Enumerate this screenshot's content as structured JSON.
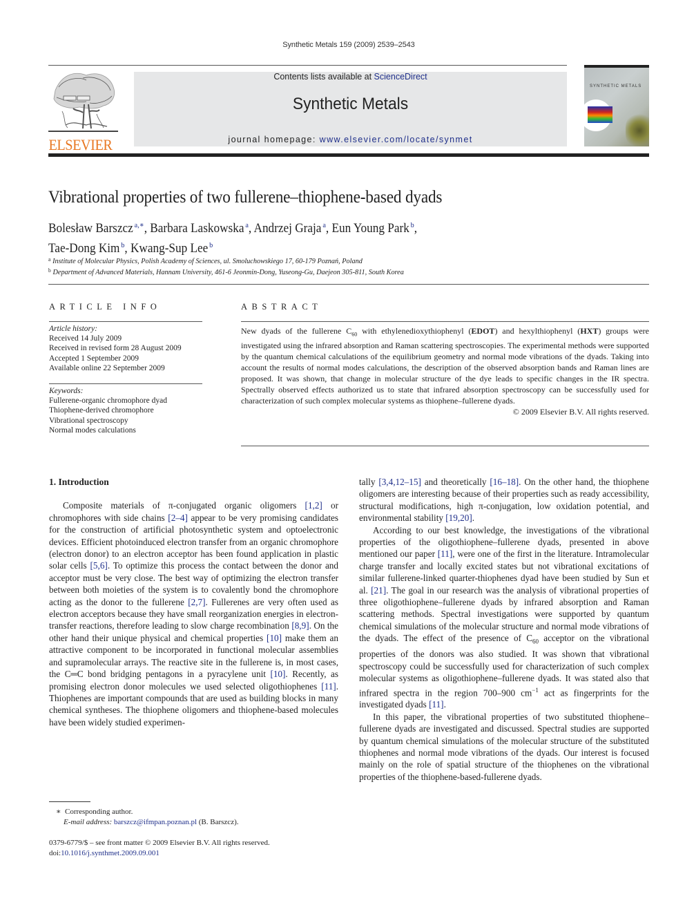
{
  "running_head": "Synthetic Metals 159 (2009) 2539–2543",
  "masthead": {
    "publisher_logo_text": "ELSEVIER",
    "contents_prefix": "Contents lists available at ",
    "contents_link": "ScienceDirect",
    "journal_title": "Synthetic Metals",
    "homepage_prefix": "journal homepage: ",
    "homepage_link": "www.elsevier.com/locate/synmet",
    "cover_title": "SYNTHETIC METALS"
  },
  "colors": {
    "elsevier_orange": "#e87722",
    "link_blue": "#1f2f8a",
    "masthead_grey": "#e6e7e8"
  },
  "article": {
    "title": "Vibrational properties of two fullerene–thiophene-based dyads",
    "authors": [
      {
        "name": "Bolesław Barszcz",
        "affil": "a,∗",
        "sep": ", "
      },
      {
        "name": "Barbara Laskowska",
        "affil": "a",
        "sep": ", "
      },
      {
        "name": "Andrzej Graja",
        "affil": "a",
        "sep": ", "
      },
      {
        "name": "Eun Young Park",
        "affil": "b",
        "sep": ","
      },
      {
        "name": "Tae-Dong Kim",
        "affil": "b",
        "sep": ", "
      },
      {
        "name": "Kwang-Sup Lee",
        "affil": "b",
        "sep": ""
      }
    ],
    "affiliations": [
      {
        "mark": "a",
        "text": "Institute of Molecular Physics, Polish Academy of Sciences, ul. Smoluchowskiego 17, 60-179 Poznań, Poland"
      },
      {
        "mark": "b",
        "text": "Department of Advanced Materials, Hannam University, 461-6 Jeonmin-Dong, Yuseong-Gu, Daejeon 305-811, South Korea"
      }
    ]
  },
  "article_info": {
    "heading": "ARTICLE INFO",
    "history_label": "Article history:",
    "history": [
      "Received 14 July 2009",
      "Received in revised form 28 August 2009",
      "Accepted 1 September 2009",
      "Available online 22 September 2009"
    ],
    "keywords_label": "Keywords:",
    "keywords": [
      "Fullerene-organic chromophore dyad",
      "Thiophene-derived chromophore",
      "Vibrational spectroscopy",
      "Normal modes calculations"
    ]
  },
  "abstract": {
    "heading": "ABSTRACT",
    "p1_a": "New dyads of the fullerene C",
    "p1_sub": "60",
    "p1_b": " with ethylenedioxythiophenyl (",
    "p1_edot": "EDOT",
    "p1_c": ") and hexylthiophenyl (",
    "p1_hxt": "HXT",
    "p1_d": ") groups were investigated using the infrared absorption and Raman scattering spectroscopies. The experimental methods were supported by the quantum chemical calculations of the equilibrium geometry and normal mode vibrations of the dyads. Taking into account the results of normal modes calculations, the description of the observed absorption bands and Raman lines are proposed. It was shown, that change in molecular structure of the dye leads to specific changes in the IR spectra. Spectrally observed effects authorized us to state that infrared absorption spectroscopy can be successfully used for characterization of such complex molecular systems as thiophene–fullerene dyads.",
    "copyright": "© 2009 Elsevier B.V. All rights reserved."
  },
  "introduction": {
    "heading": "1.  Introduction",
    "left_p1": [
      {
        "t": "Composite materials of π-conjugated organic oligomers "
      },
      {
        "ref": "[1,2]"
      },
      {
        "t": " or chromophores with side chains "
      },
      {
        "ref": "[2–4]"
      },
      {
        "t": " appear to be very promising candidates for the construction of artificial photosynthetic system and optoelectronic devices. Efficient photoinduced electron transfer from an organic chromophore (electron donor) to an electron acceptor has been found application in plastic solar cells "
      },
      {
        "ref": "[5,6]"
      },
      {
        "t": ". To optimize this process the contact between the donor and acceptor must be very close. The best way of optimizing the electron transfer between both moieties of the system is to covalently bond the chromophore acting as the donor to the fullerene "
      },
      {
        "ref": "[2,7]"
      },
      {
        "t": ". Fullerenes are very often used as electron acceptors because they have small reorganization energies in electron-transfer reactions, therefore leading to slow charge recombination "
      },
      {
        "ref": "[8,9]"
      },
      {
        "t": ". On the other hand their unique physical and chemical properties "
      },
      {
        "ref": "[10]"
      },
      {
        "t": " make them an attractive component to be incorporated in functional molecular assemblies and supramolecular arrays. The reactive site in the fullerene is, in most cases, the C═C bond bridging pentagons in a pyracylene unit "
      },
      {
        "ref": "[10]"
      },
      {
        "t": ". Recently, as promising electron donor molecules we used selected oligothiophenes "
      },
      {
        "ref": "[11]"
      },
      {
        "t": ". Thiophenes are important compounds that are used as building blocks in many chemical syntheses. The thiophene oligomers and thiophene-based molecules have been widely studied experimen-"
      }
    ],
    "right_p1": [
      {
        "t": "tally "
      },
      {
        "ref": "[3,4,12–15]"
      },
      {
        "t": " and theoretically "
      },
      {
        "ref": "[16–18]"
      },
      {
        "t": ". On the other hand, the thiophene oligomers are interesting because of their properties such as ready accessibility, structural modifications, high π-conjugation, low oxidation potential, and environmental stability "
      },
      {
        "ref": "[19,20]"
      },
      {
        "t": "."
      }
    ],
    "right_p2": [
      {
        "t": "According to our best knowledge, the investigations of the vibrational properties of the oligothiophene–fullerene dyads, presented in above mentioned our paper "
      },
      {
        "ref": "[11]"
      },
      {
        "t": ", were one of the first in the literature. Intramolecular charge transfer and locally excited states but not vibrational excitations of similar fullerene-linked quarter-thiophenes dyad have been studied by Sun et al. "
      },
      {
        "ref": "[21]"
      },
      {
        "t": ". The goal in our research was the analysis of vibrational properties of three oligothiophene–fullerene dyads by infrared absorption and Raman scattering methods. Spectral investigations were supported by quantum chemical simulations of the molecular structure and normal mode vibrations of the dyads. The effect of the presence of C"
      },
      {
        "sub": "60"
      },
      {
        "t": " acceptor on the vibrational properties of the donors was also studied. It was shown that vibrational spectroscopy could be successfully used for characterization of such complex molecular systems as oligothiophene–fullerene dyads. It was stated also that infrared spectra in the region 700–900 cm"
      },
      {
        "sup": "−1"
      },
      {
        "t": " act as fingerprints for the investigated dyads "
      },
      {
        "ref": "[11]"
      },
      {
        "t": "."
      }
    ],
    "right_p3": [
      {
        "t": "In this paper, the vibrational properties of two substituted thiophene–fullerene dyads are investigated and discussed. Spectral studies are supported by quantum chemical simulations of the molecular structure of the substituted thiophenes and normal mode vibrations of the dyads. Our interest is focused mainly on the role of spatial structure of the thiophenes on the vibrational properties of the thiophene-based-fullerene dyads."
      }
    ]
  },
  "footnote": {
    "mark": "∗",
    "corresponding": "Corresponding author.",
    "email_label": "E-mail address:",
    "email": "barszcz@ifmpan.poznan.pl",
    "email_owner": " (B. Barszcz)."
  },
  "front_matter": {
    "issn_line": "0379-6779/$ – see front matter © 2009 Elsevier B.V. All rights reserved.",
    "doi_prefix": "doi:",
    "doi": "10.1016/j.synthmet.2009.09.001"
  }
}
